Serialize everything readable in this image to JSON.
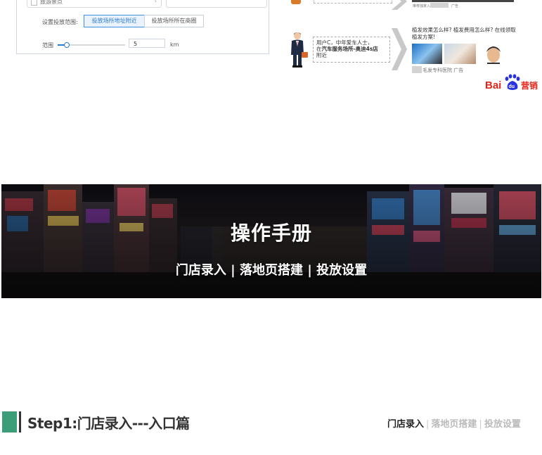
{
  "settings_panel": {
    "category_option": "旅游景点",
    "range_setting_label": "设置投放范围:",
    "range_options": [
      "投放场所地址附近",
      "投放场所所在商圈"
    ],
    "range_label": "范围",
    "range_value": "5",
    "range_unit": "km"
  },
  "ad_example": {
    "top_caption_1": "推荐独家入",
    "top_caption_2": "广告",
    "user_bubble_line1": "用户C，中年爱车人士，",
    "user_bubble_prefix": "在",
    "user_bubble_bold": "汽车服务场所-奥迪4s店",
    "user_bubble_suffix": "附近",
    "ad_title": "植发效果怎么样? 植发费用怎么样? 在线领取植发方案!",
    "ad_footer": "毛发专科医院 广告",
    "brand": "Bai du 营销",
    "brand_part1": "Bai",
    "brand_part2": "du",
    "brand_part3": "营销",
    "brand_color_red": "#e1251b",
    "brand_color_blue": "#2932e1"
  },
  "banner": {
    "title": "操作手册",
    "subtitle": "门店录入 | 落地页搭建 | 投放设置"
  },
  "step": {
    "title": "Step1:门店录入---入口篇",
    "accent_color": "#3b9e78",
    "breadcrumb": {
      "current": "门店录入",
      "sep": "|",
      "next1": "落地页搭建",
      "next2": "投放设置"
    }
  }
}
